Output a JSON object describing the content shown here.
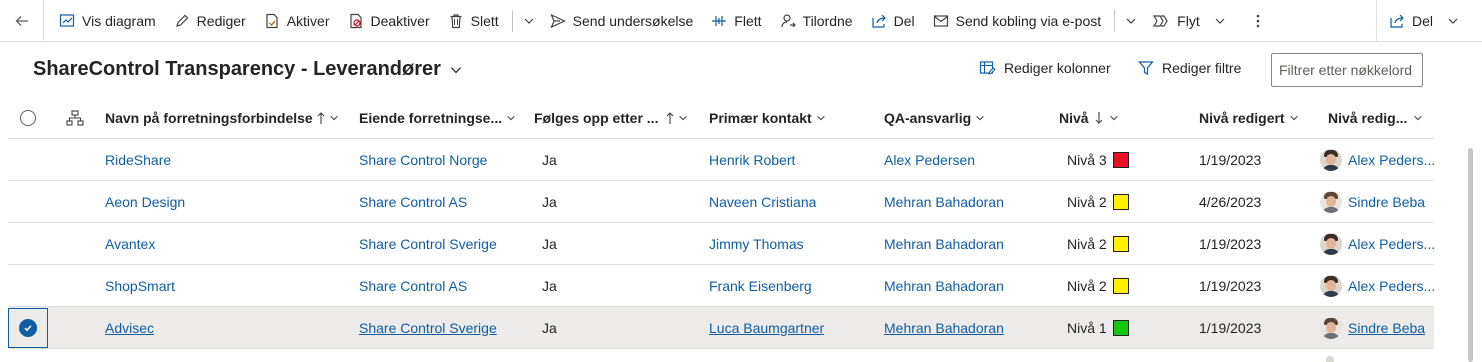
{
  "commandbar": {
    "items": [
      {
        "label": "Vis diagram",
        "icon": "chart-icon"
      },
      {
        "label": "Rediger",
        "icon": "pencil-icon"
      },
      {
        "label": "Aktiver",
        "icon": "activate-icon"
      },
      {
        "label": "Deaktiver",
        "icon": "deactivate-icon"
      },
      {
        "label": "Slett",
        "icon": "trash-icon"
      },
      {
        "label": "Send undersøkelse",
        "icon": "send-icon"
      },
      {
        "label": "Flett",
        "icon": "merge-icon"
      },
      {
        "label": "Tilordne",
        "icon": "assign-icon"
      },
      {
        "label": "Del",
        "icon": "share-icon"
      },
      {
        "label": "Send kobling via e-post",
        "icon": "email-link-icon"
      },
      {
        "label": "Flyt",
        "icon": "flow-icon"
      }
    ],
    "right_share_label": "Del"
  },
  "view": {
    "title": "ShareControl Transparency - Leverandører",
    "edit_columns_label": "Rediger kolonner",
    "edit_filters_label": "Rediger filtre",
    "filter_placeholder": "Filtrer etter nøkkelord"
  },
  "grid": {
    "columns": [
      "Navn på forretningsforbindelse",
      "Eiende forretningse...",
      "Følges opp etter ...",
      "Primær kontakt",
      "QA-ansvarlig",
      "Nivå",
      "Nivå redigert",
      "Nivå redig..."
    ],
    "rows": [
      {
        "name": "RideShare",
        "owner": "Share Control Norge",
        "followed": "Ja",
        "contact": "Henrik Robert",
        "qa": "Alex Pedersen",
        "level": "Nivå 3",
        "level_color": "#e81123",
        "level_edited": "1/19/2023",
        "edited_by": "Alex Peders...",
        "selected": false
      },
      {
        "name": "Aeon Design",
        "owner": "Share Control AS",
        "followed": "Ja",
        "contact": "Naveen Cristiana",
        "qa": "Mehran Bahadoran",
        "level": "Nivå 2",
        "level_color": "#fff100",
        "level_edited": "4/26/2023",
        "edited_by": "Sindre Beba",
        "selected": false
      },
      {
        "name": "Avantex",
        "owner": "Share Control Sverige",
        "followed": "Ja",
        "contact": "Jimmy Thomas",
        "qa": "Mehran Bahadoran",
        "level": "Nivå 2",
        "level_color": "#fff100",
        "level_edited": "1/19/2023",
        "edited_by": "Alex Peders...",
        "selected": false
      },
      {
        "name": "ShopSmart",
        "owner": "Share Control AS",
        "followed": "Ja",
        "contact": "Frank Eisenberg",
        "qa": "Mehran Bahadoran",
        "level": "Nivå 2",
        "level_color": "#fff100",
        "level_edited": "1/19/2023",
        "edited_by": "Alex Peders...",
        "selected": false
      },
      {
        "name": "Advisec",
        "owner": "Share Control Sverige",
        "followed": "Ja",
        "contact": "Luca Baumgartner",
        "qa": "Mehran Bahadoran",
        "level": "Nivå 1",
        "level_color": "#16c60c",
        "level_edited": "1/19/2023",
        "edited_by": "Sindre Beba",
        "selected": true
      }
    ]
  }
}
